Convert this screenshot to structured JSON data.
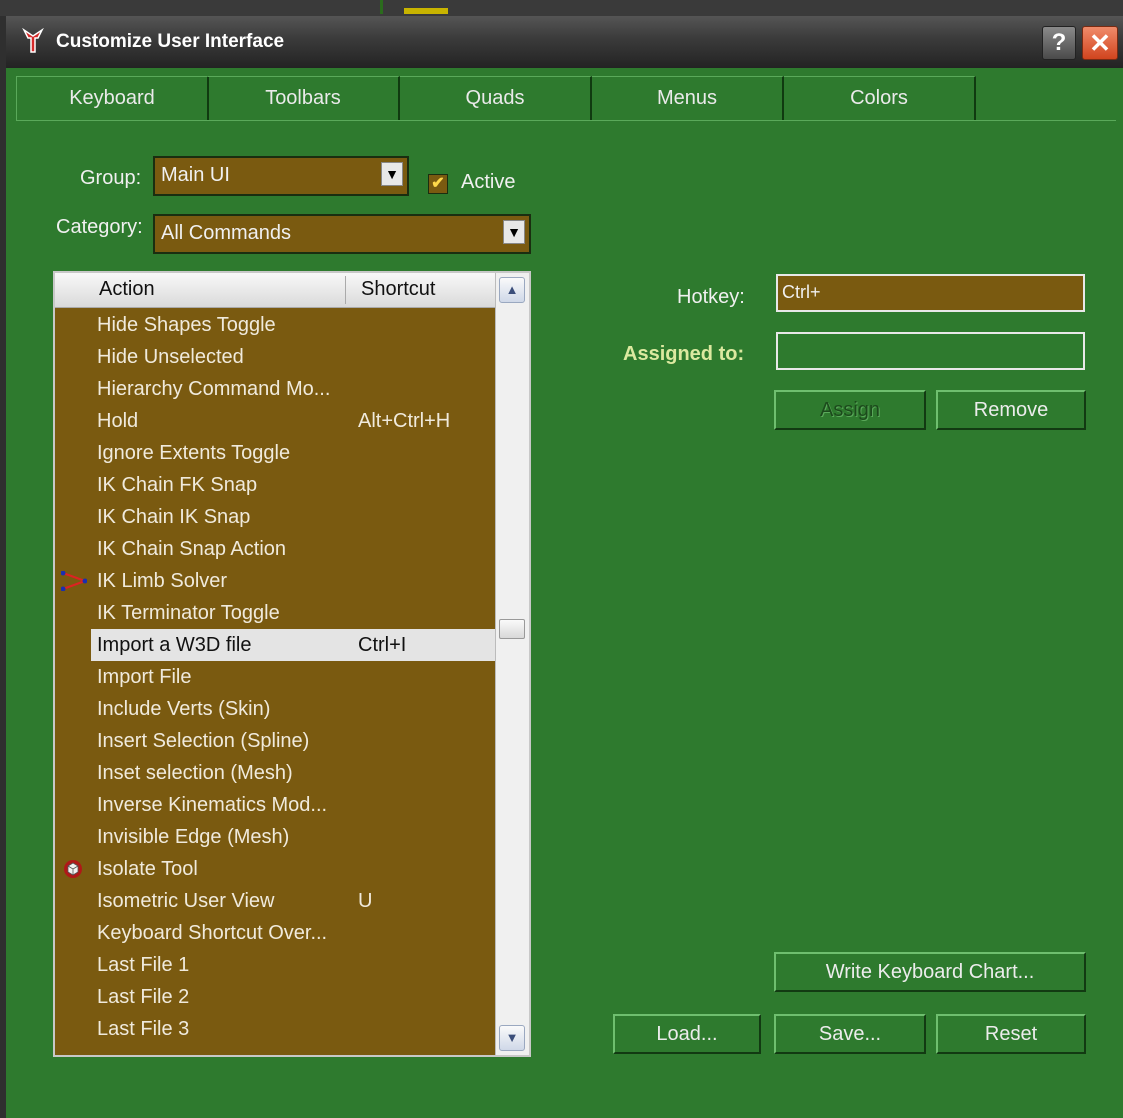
{
  "window": {
    "title": "Customize User Interface",
    "help_glyph": "?",
    "close_glyph": "✕"
  },
  "tabs": [
    "Keyboard",
    "Toolbars",
    "Quads",
    "Menus",
    "Colors"
  ],
  "group": {
    "label": "Group:",
    "value": "Main UI"
  },
  "active": {
    "label": "Active",
    "checked": true
  },
  "category": {
    "label": "Category:",
    "value": "All Commands"
  },
  "list": {
    "headers": {
      "action": "Action",
      "shortcut": "Shortcut"
    },
    "rows": [
      {
        "name": "Hide Shapes Toggle",
        "shortcut": ""
      },
      {
        "name": "Hide Unselected",
        "shortcut": ""
      },
      {
        "name": "Hierarchy Command Mo...",
        "shortcut": ""
      },
      {
        "name": "Hold",
        "shortcut": "Alt+Ctrl+H"
      },
      {
        "name": "Ignore Extents Toggle",
        "shortcut": ""
      },
      {
        "name": "IK Chain FK Snap",
        "shortcut": ""
      },
      {
        "name": "IK Chain IK Snap",
        "shortcut": ""
      },
      {
        "name": "IK Chain Snap Action",
        "shortcut": ""
      },
      {
        "name": "IK Limb Solver",
        "shortcut": "",
        "icon": "ik-limb-icon"
      },
      {
        "name": "IK Terminator Toggle",
        "shortcut": ""
      },
      {
        "name": "Import a W3D file",
        "shortcut": "Ctrl+I",
        "selected": true
      },
      {
        "name": "Import File",
        "shortcut": ""
      },
      {
        "name": "Include Verts (Skin)",
        "shortcut": ""
      },
      {
        "name": "Insert Selection (Spline)",
        "shortcut": ""
      },
      {
        "name": "Inset selection (Mesh)",
        "shortcut": ""
      },
      {
        "name": "Inverse Kinematics Mod...",
        "shortcut": ""
      },
      {
        "name": "Invisible Edge (Mesh)",
        "shortcut": ""
      },
      {
        "name": "Isolate Tool",
        "shortcut": "",
        "icon": "isolate-cube-icon"
      },
      {
        "name": "Isometric User View",
        "shortcut": "U"
      },
      {
        "name": "Keyboard Shortcut Over...",
        "shortcut": ""
      },
      {
        "name": "Last File 1",
        "shortcut": ""
      },
      {
        "name": "Last File 2",
        "shortcut": ""
      },
      {
        "name": "Last File 3",
        "shortcut": ""
      }
    ]
  },
  "hotkey": {
    "label": "Hotkey:",
    "value": "Ctrl+"
  },
  "assigned": {
    "label": "Assigned to:",
    "value": ""
  },
  "buttons": {
    "assign": "Assign",
    "remove": "Remove",
    "write_chart": "Write Keyboard Chart...",
    "load": "Load...",
    "save": "Save...",
    "reset": "Reset"
  },
  "colors": {
    "panel": "#2e7a2e",
    "list_bg": "#7a5a10",
    "assigned_label": "#dce9a0"
  }
}
